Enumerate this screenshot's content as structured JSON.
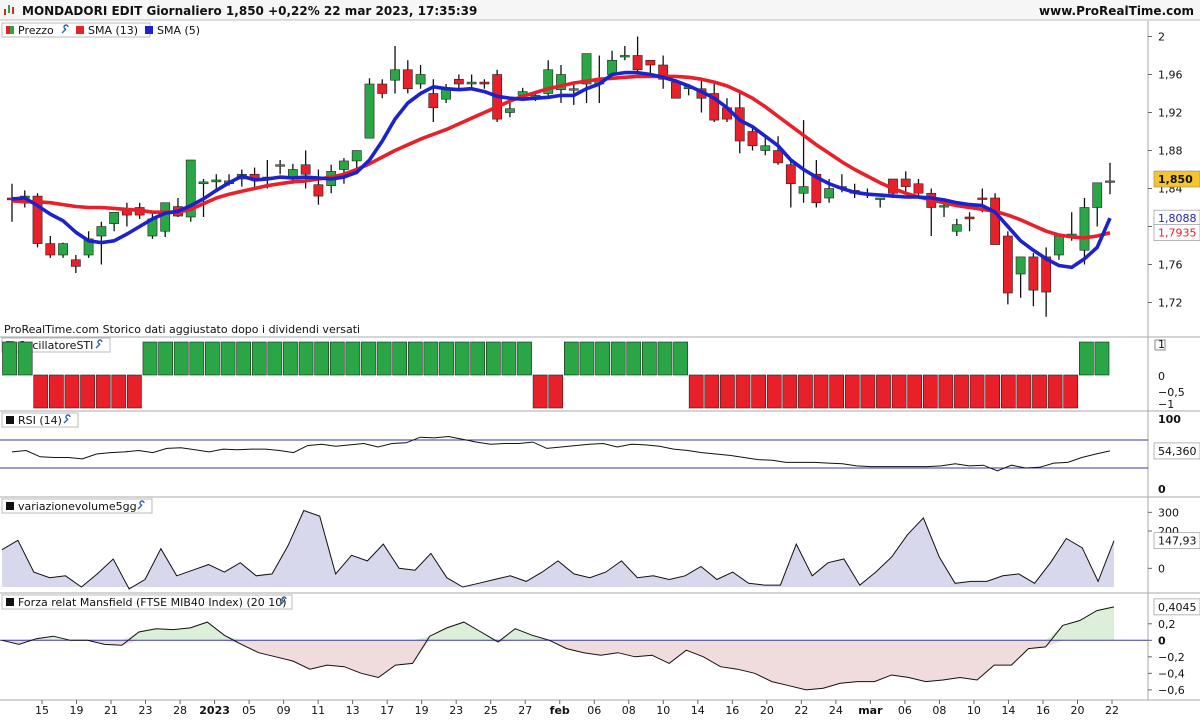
{
  "header": {
    "title": "MONDADORI EDIT Giornaliero 1,850 +0,22% 22 mar 2023, 17:35:39",
    "site": "www.ProRealTime.com"
  },
  "colors": {
    "up": "#2aa646",
    "down": "#e8202a",
    "sma13": "#e8202a",
    "sma5": "#1c22cc",
    "ref_line": "#3a3aaa",
    "volume_fill": "#d8d8ec",
    "mansfield_pos_fill": "#dcefd9",
    "mansfield_neg_fill": "#f0dcdc",
    "last_price_bg": "#f5c52b"
  },
  "panels": {
    "price": {
      "legend": [
        "Prezzo",
        "SMA (13)",
        "SMA (5)"
      ],
      "note": "ProRealTime.com Storico dati aggiustato dopo i dividendi versati",
      "last_price_label": "1,850",
      "sma5_label": "1,8088",
      "sma13_label": "1,7935",
      "y_ticks": [
        "2",
        "1,96",
        "1,92",
        "1,88",
        "1,84",
        "1,80",
        "1,76",
        "1,72"
      ]
    },
    "oscillator": {
      "legend": "OscillatoreSTI",
      "y_ticks": [
        "1",
        "0",
        "−0,5",
        "−1"
      ]
    },
    "rsi": {
      "legend": "RSI (14)",
      "value_label": "54,360",
      "y_ticks": [
        "100",
        "0"
      ]
    },
    "volume": {
      "legend": "variazionevolume5gg",
      "value_label": "147,93",
      "y_ticks": [
        "300",
        "200",
        "100",
        "0"
      ]
    },
    "mansfield": {
      "legend": "Forza relat Mansfield (FTSE MIB40 Index) (20 10)",
      "value_label": "0,4045",
      "y_ticks": [
        "0,2",
        "0",
        "−0,2",
        "−0,4",
        "−0,6"
      ]
    }
  },
  "chart_data": [
    {
      "type": "candlestick",
      "title": "MONDADORI EDIT Giornaliero",
      "x_labels": [
        "15",
        "19",
        "21",
        "23",
        "28",
        "2023",
        "05",
        "09",
        "11",
        "13",
        "17",
        "19",
        "23",
        "25",
        "27",
        "feb",
        "06",
        "08",
        "10",
        "14",
        "16",
        "20",
        "22",
        "24",
        "mar",
        "06",
        "08",
        "10",
        "14",
        "16",
        "20",
        "22"
      ],
      "ylim": [
        1.69,
        2.01
      ],
      "series": [
        {
          "name": "Prezzo",
          "ohlc": [
            [
              1.83,
              1.845,
              1.805,
              1.828
            ],
            [
              1.83,
              1.838,
              1.82,
              1.832
            ],
            [
              1.832,
              1.835,
              1.778,
              1.782
            ],
            [
              1.782,
              1.79,
              1.767,
              1.77
            ],
            [
              1.77,
              1.783,
              1.767,
              1.782
            ],
            [
              1.765,
              1.77,
              1.751,
              1.758
            ],
            [
              1.77,
              1.795,
              1.767,
              1.787
            ],
            [
              1.79,
              1.805,
              1.76,
              1.8
            ],
            [
              1.803,
              1.815,
              1.795,
              1.815
            ],
            [
              1.819,
              1.825,
              1.8,
              1.812
            ],
            [
              1.82,
              1.825,
              1.808,
              1.812
            ],
            [
              1.79,
              1.815,
              1.787,
              1.808
            ],
            [
              1.795,
              1.825,
              1.789,
              1.825
            ],
            [
              1.821,
              1.83,
              1.81,
              1.811
            ],
            [
              1.81,
              1.87,
              1.805,
              1.87
            ],
            [
              1.845,
              1.85,
              1.81,
              1.847
            ],
            [
              1.847,
              1.855,
              1.836,
              1.849
            ],
            [
              1.845,
              1.855,
              1.843,
              1.848
            ],
            [
              1.85,
              1.86,
              1.842,
              1.855
            ],
            [
              1.855,
              1.862,
              1.84,
              1.849
            ],
            [
              1.852,
              1.87,
              1.84,
              1.85
            ],
            [
              1.865,
              1.87,
              1.855,
              1.865
            ],
            [
              1.85,
              1.866,
              1.845,
              1.86
            ],
            [
              1.865,
              1.88,
              1.84,
              1.855
            ],
            [
              1.844,
              1.86,
              1.823,
              1.832
            ],
            [
              1.843,
              1.865,
              1.835,
              1.858
            ],
            [
              1.86,
              1.872,
              1.845,
              1.869
            ],
            [
              1.869,
              1.88,
              1.855,
              1.88
            ],
            [
              1.893,
              1.956,
              1.893,
              1.95
            ],
            [
              1.95,
              1.955,
              1.935,
              1.94
            ],
            [
              1.954,
              1.99,
              1.94,
              1.965
            ],
            [
              1.965,
              1.975,
              1.94,
              1.945
            ],
            [
              1.95,
              1.97,
              1.945,
              1.96
            ],
            [
              1.94,
              1.955,
              1.91,
              1.925
            ],
            [
              1.934,
              1.95,
              1.93,
              1.945
            ],
            [
              1.955,
              1.96,
              1.945,
              1.95
            ],
            [
              1.95,
              1.96,
              1.945,
              1.952
            ],
            [
              1.952,
              1.955,
              1.945,
              1.95
            ],
            [
              1.96,
              1.965,
              1.91,
              1.913
            ],
            [
              1.92,
              1.93,
              1.915,
              1.924
            ],
            [
              1.938,
              1.946,
              1.935,
              1.942
            ],
            [
              1.935,
              1.94,
              1.932,
              1.938
            ],
            [
              1.94,
              1.975,
              1.935,
              1.965
            ],
            [
              1.944,
              1.97,
              1.93,
              1.96
            ],
            [
              1.944,
              1.95,
              1.928,
              1.945
            ],
            [
              1.95,
              1.982,
              1.93,
              1.982
            ],
            [
              1.95,
              1.98,
              1.93,
              1.955
            ],
            [
              1.96,
              1.985,
              1.955,
              1.975
            ],
            [
              1.98,
              1.99,
              1.975,
              1.98
            ],
            [
              1.98,
              2.0,
              1.96,
              1.965
            ],
            [
              1.975,
              1.975,
              1.96,
              1.97
            ],
            [
              1.97,
              1.98,
              1.945,
              1.955
            ],
            [
              1.952,
              1.955,
              1.935,
              1.935
            ],
            [
              1.945,
              1.95,
              1.938,
              1.947
            ],
            [
              1.945,
              1.955,
              1.92,
              1.935
            ],
            [
              1.94,
              1.95,
              1.91,
              1.912
            ],
            [
              1.925,
              1.935,
              1.91,
              1.913
            ],
            [
              1.925,
              1.94,
              1.877,
              1.89
            ],
            [
              1.9,
              1.905,
              1.88,
              1.885
            ],
            [
              1.88,
              1.895,
              1.875,
              1.885
            ],
            [
              1.88,
              1.895,
              1.865,
              1.867
            ],
            [
              1.865,
              1.87,
              1.82,
              1.845
            ],
            [
              1.835,
              1.912,
              1.825,
              1.842
            ],
            [
              1.855,
              1.87,
              1.82,
              1.825
            ],
            [
              1.83,
              1.85,
              1.825,
              1.84
            ],
            [
              1.842,
              1.855,
              1.836,
              1.84
            ],
            [
              1.838,
              1.845,
              1.83,
              1.835
            ],
            [
              1.835,
              1.84,
              1.83,
              1.833
            ],
            [
              1.83,
              1.83,
              1.82,
              1.83
            ],
            [
              1.85,
              1.85,
              1.83,
              1.835
            ],
            [
              1.85,
              1.858,
              1.835,
              1.842
            ],
            [
              1.845,
              1.85,
              1.832,
              1.835
            ],
            [
              1.835,
              1.84,
              1.79,
              1.82
            ],
            [
              1.822,
              1.828,
              1.81,
              1.822
            ],
            [
              1.795,
              1.808,
              1.79,
              1.802
            ],
            [
              1.81,
              1.815,
              1.795,
              1.808
            ],
            [
              1.83,
              1.84,
              1.815,
              1.829
            ],
            [
              1.83,
              1.835,
              1.781,
              1.781
            ],
            [
              1.79,
              1.795,
              1.718,
              1.73
            ],
            [
              1.75,
              1.768,
              1.725,
              1.768
            ],
            [
              1.768,
              1.772,
              1.716,
              1.733
            ],
            [
              1.768,
              1.778,
              1.705,
              1.731
            ],
            [
              1.77,
              1.79,
              1.765,
              1.79
            ],
            [
              1.79,
              1.815,
              1.785,
              1.792
            ],
            [
              1.775,
              1.83,
              1.76,
              1.82
            ],
            [
              1.82,
              1.846,
              1.8,
              1.846
            ],
            [
              1.847,
              1.867,
              1.834,
              1.848
            ]
          ]
        },
        {
          "name": "SMA (13)",
          "values": [
            1.827,
            1.826,
            1.826,
            1.825,
            1.823,
            1.821,
            1.82,
            1.82,
            1.819,
            1.818,
            1.817,
            1.815,
            1.815,
            1.815,
            1.818,
            1.824,
            1.83,
            1.834,
            1.837,
            1.84,
            1.843,
            1.845,
            1.847,
            1.848,
            1.85,
            1.852,
            1.855,
            1.86,
            1.866,
            1.873,
            1.88,
            1.886,
            1.892,
            1.897,
            1.902,
            1.908,
            1.914,
            1.92,
            1.926,
            1.932,
            1.937,
            1.941,
            1.945,
            1.948,
            1.951,
            1.953,
            1.955,
            1.956,
            1.957,
            1.958,
            1.958,
            1.958,
            1.958,
            1.957,
            1.955,
            1.952,
            1.948,
            1.942,
            1.935,
            1.926,
            1.916,
            1.906,
            1.896,
            1.886,
            1.877,
            1.868,
            1.86,
            1.853,
            1.846,
            1.84,
            1.835,
            1.831,
            1.828,
            1.825,
            1.822,
            1.82,
            1.818,
            1.816,
            1.812,
            1.807,
            1.801,
            1.795,
            1.791,
            1.789,
            1.788,
            1.79,
            1.7935
          ]
        },
        {
          "name": "SMA (5)",
          "values": [
            1.829,
            1.83,
            1.822,
            1.813,
            1.806,
            1.794,
            1.785,
            1.783,
            1.785,
            1.792,
            1.8,
            1.808,
            1.814,
            1.816,
            1.822,
            1.829,
            1.838,
            1.846,
            1.853,
            1.849,
            1.85,
            1.852,
            1.851,
            1.852,
            1.851,
            1.85,
            1.852,
            1.857,
            1.87,
            1.89,
            1.913,
            1.93,
            1.94,
            1.947,
            1.945,
            1.944,
            1.945,
            1.942,
            1.937,
            1.935,
            1.934,
            1.935,
            1.936,
            1.938,
            1.938,
            1.945,
            1.95,
            1.96,
            1.962,
            1.962,
            1.96,
            1.957,
            1.953,
            1.948,
            1.942,
            1.935,
            1.925,
            1.912,
            1.905,
            1.895,
            1.885,
            1.87,
            1.86,
            1.852,
            1.845,
            1.84,
            1.836,
            1.834,
            1.833,
            1.832,
            1.831,
            1.831,
            1.83,
            1.828,
            1.825,
            1.823,
            1.822,
            1.815,
            1.8,
            1.785,
            1.775,
            1.766,
            1.759,
            1.757,
            1.766,
            1.778,
            1.8088
          ]
        }
      ]
    },
    {
      "type": "bar",
      "title": "OscillatoreSTI",
      "ylim": [
        -1,
        1
      ],
      "values": [
        1,
        1,
        -1,
        -1,
        -1,
        -1,
        -1,
        -1,
        -1,
        1,
        1,
        1,
        1,
        1,
        1,
        1,
        1,
        1,
        1,
        1,
        1,
        1,
        1,
        1,
        1,
        1,
        1,
        1,
        1,
        1,
        1,
        1,
        1,
        1,
        -1,
        -1,
        1,
        1,
        1,
        1,
        1,
        1,
        1,
        1,
        -1,
        -1,
        -1,
        -1,
        -1,
        -1,
        -1,
        -1,
        -1,
        -1,
        -1,
        -1,
        -1,
        -1,
        -1,
        -1,
        -1,
        -1,
        -1,
        -1,
        -1,
        -1,
        -1,
        -1,
        -1,
        1,
        1
      ]
    },
    {
      "type": "line",
      "title": "RSI (14)",
      "ylim": [
        0,
        100
      ],
      "reference_lines": [
        70,
        30
      ],
      "values": [
        53,
        55,
        46,
        45,
        45,
        43,
        50,
        52,
        53,
        55,
        52,
        58,
        59,
        56,
        53,
        57,
        56,
        57,
        57,
        55,
        52,
        62,
        64,
        61,
        63,
        65,
        60,
        65,
        66,
        74,
        73,
        75,
        71,
        67,
        64,
        65,
        65,
        67,
        58,
        60,
        62,
        64,
        65,
        60,
        64,
        63,
        61,
        57,
        55,
        52,
        50,
        48,
        45,
        42,
        41,
        38,
        38,
        38,
        37,
        36,
        33,
        32,
        32,
        32,
        32,
        32,
        33,
        36,
        33,
        34,
        26,
        34,
        30,
        31,
        37,
        38,
        45,
        50,
        54.36
      ]
    },
    {
      "type": "area",
      "title": "variazionevolume5gg",
      "ylim": [
        -100,
        350
      ],
      "values": [
        100,
        150,
        -20,
        -50,
        -40,
        -100,
        -30,
        50,
        -110,
        -60,
        105,
        -40,
        -10,
        20,
        -20,
        30,
        -40,
        -30,
        120,
        310,
        280,
        -30,
        70,
        40,
        130,
        0,
        -10,
        80,
        -50,
        -100,
        -80,
        -60,
        -40,
        -70,
        -20,
        40,
        -30,
        -50,
        -20,
        40,
        -50,
        -40,
        -60,
        -40,
        10,
        -60,
        -20,
        -80,
        -90,
        -90,
        130,
        -40,
        30,
        50,
        -90,
        -20,
        60,
        180,
        270,
        60,
        -80,
        -70,
        -70,
        -40,
        -30,
        -80,
        30,
        160,
        110,
        -70,
        147.93
      ]
    },
    {
      "type": "area",
      "title": "Forza relat Mansfield (FTSE MIB40 Index) (20 10)",
      "ylim": [
        -0.65,
        0.5
      ],
      "values": [
        0.0,
        -0.05,
        0.02,
        0.05,
        0.0,
        0.0,
        -0.05,
        -0.06,
        0.1,
        0.14,
        0.13,
        0.15,
        0.22,
        0.06,
        -0.05,
        -0.15,
        -0.2,
        -0.25,
        -0.35,
        -0.3,
        -0.32,
        -0.4,
        -0.45,
        -0.3,
        -0.28,
        0.05,
        0.15,
        0.22,
        0.1,
        -0.02,
        0.14,
        0.06,
        0.0,
        -0.1,
        -0.15,
        -0.18,
        -0.15,
        -0.2,
        -0.18,
        -0.28,
        -0.12,
        -0.2,
        -0.32,
        -0.35,
        -0.4,
        -0.5,
        -0.55,
        -0.6,
        -0.58,
        -0.52,
        -0.5,
        -0.5,
        -0.42,
        -0.45,
        -0.5,
        -0.48,
        -0.45,
        -0.48,
        -0.3,
        -0.3,
        -0.1,
        -0.08,
        0.18,
        0.24,
        0.36,
        0.4045
      ]
    }
  ]
}
